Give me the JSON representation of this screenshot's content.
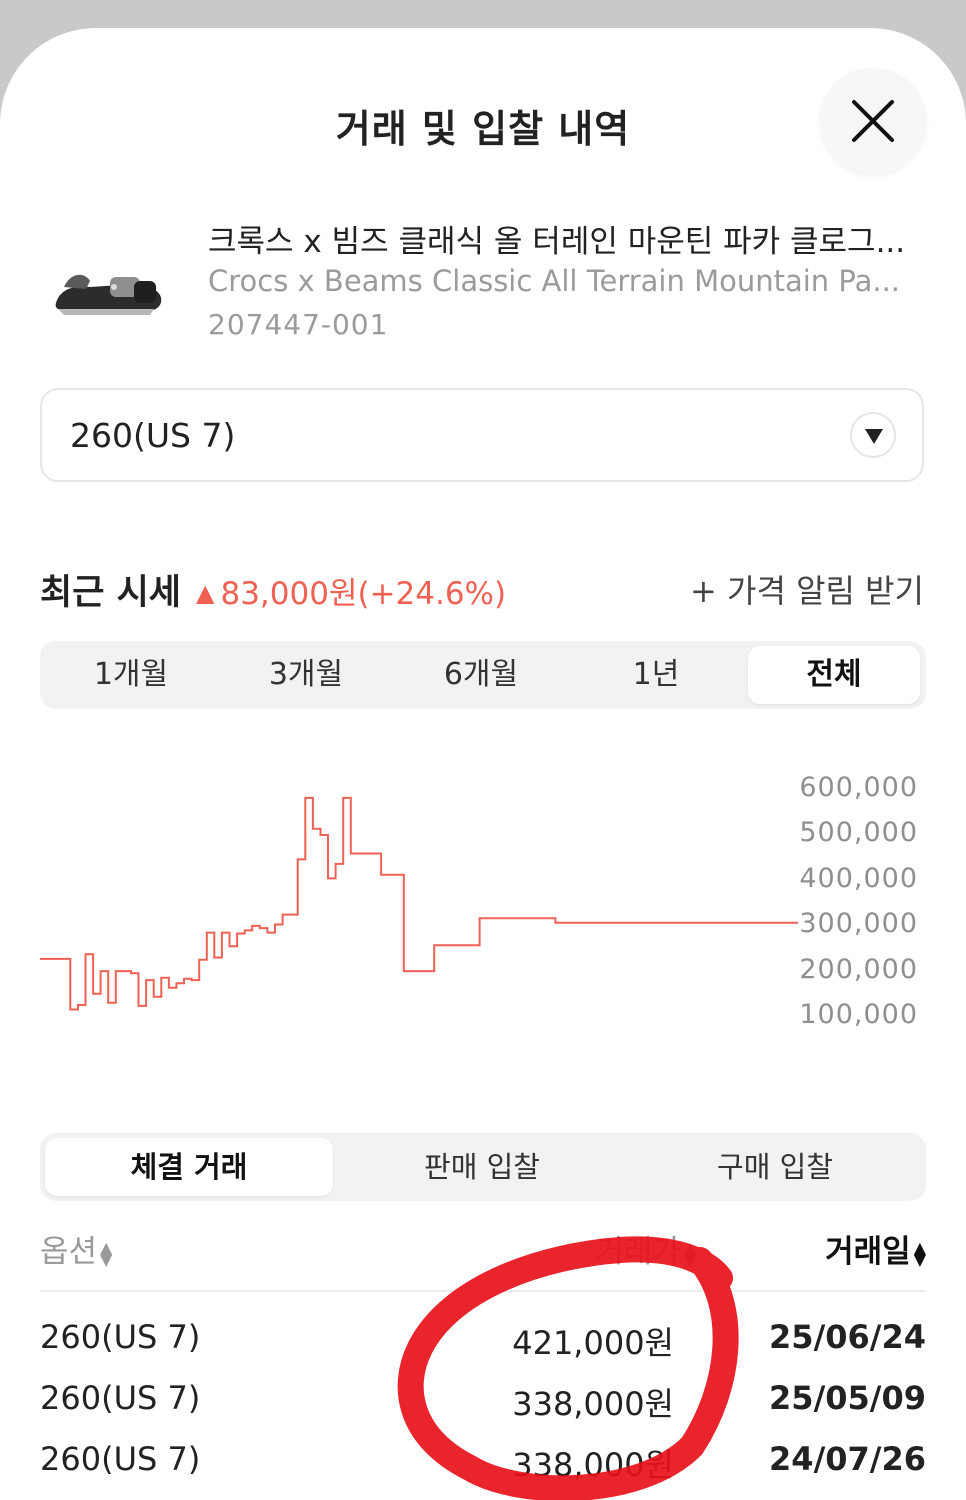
{
  "header": {
    "title": "거래 및 입찰 내역"
  },
  "product": {
    "name_ko": "크록스 x 빔즈 클래식 올 터레인 마운틴 파카 클로그...",
    "name_en": "Crocs x Beams Classic All Terrain Mountain Pa...",
    "code": "207447-001"
  },
  "size_select": {
    "value": "260(US 7)"
  },
  "price_summary": {
    "label": "최근 시세",
    "direction_icon": "▲",
    "change": "83,000원(+24.6%)",
    "change_color": "#ef6253",
    "alert_link": "+ 가격 알림 받기"
  },
  "period_tabs": [
    {
      "label": "1개월"
    },
    {
      "label": "3개월"
    },
    {
      "label": "6개월"
    },
    {
      "label": "1년"
    },
    {
      "label": "전체",
      "active": true
    }
  ],
  "chart_data": {
    "type": "line",
    "line_color": "#ef6253",
    "y_ticks": [
      "600,000",
      "500,000",
      "400,000",
      "300,000",
      "200,000",
      "100,000"
    ],
    "ylim": [
      100000,
      600000
    ],
    "x": [
      0,
      3,
      4,
      5,
      6,
      7,
      8,
      9,
      10,
      12,
      13,
      14,
      15,
      16,
      17,
      18,
      19,
      20,
      21,
      22,
      23,
      24,
      25,
      26,
      27,
      28,
      29,
      30,
      31,
      32,
      33,
      34,
      35,
      36,
      37,
      38,
      39,
      40,
      41,
      42,
      44,
      45,
      47,
      48,
      50,
      52,
      55,
      58,
      59,
      64,
      65,
      68,
      70,
      71,
      77,
      78,
      80,
      81,
      86,
      87,
      92,
      93,
      98,
      100
    ],
    "values": [
      222000,
      222000,
      110000,
      120000,
      232000,
      145000,
      195000,
      125000,
      195000,
      190000,
      118000,
      175000,
      138000,
      180000,
      158000,
      168000,
      178000,
      175000,
      220000,
      280000,
      225000,
      280000,
      250000,
      278000,
      285000,
      295000,
      290000,
      280000,
      298000,
      320000,
      320000,
      442000,
      578000,
      510000,
      496000,
      400000,
      432000,
      578000,
      455000,
      455000,
      455000,
      408000,
      408000,
      195000,
      195000,
      252000,
      252000,
      312000,
      312000,
      312000,
      312000,
      302000,
      302000,
      302000,
      302000,
      302000,
      302000,
      302000,
      302000,
      302000,
      302000,
      302000,
      302000,
      302000
    ]
  },
  "tx_tabs": [
    {
      "label": "체결 거래",
      "active": true
    },
    {
      "label": "판매 입찰"
    },
    {
      "label": "구매 입찰"
    }
  ],
  "table": {
    "headers": {
      "option": "옵션",
      "price": "거래가",
      "date": "거래일"
    },
    "rows": [
      {
        "option": "260(US 7)",
        "price": "421,000원",
        "date": "25/06/24"
      },
      {
        "option": "260(US 7)",
        "price": "338,000원",
        "date": "25/05/09"
      },
      {
        "option": "260(US 7)",
        "price": "338,000원",
        "date": "24/07/26"
      }
    ]
  },
  "colors": {
    "accent": "#ef6253",
    "annotation": "#e8111a"
  }
}
